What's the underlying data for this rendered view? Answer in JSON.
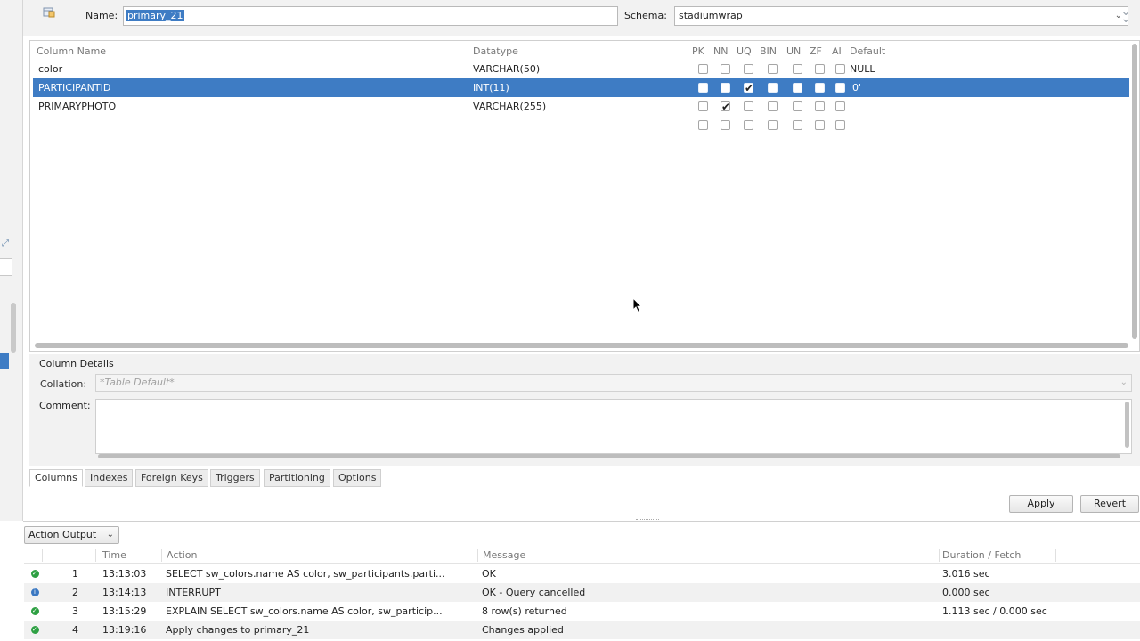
{
  "header": {
    "name_label": "Name:",
    "name_value": "primary_21",
    "schema_label": "Schema:",
    "schema_value": "stadiumwrap"
  },
  "grid": {
    "headers": {
      "column_name": "Column Name",
      "datatype": "Datatype",
      "pk": "PK",
      "nn": "NN",
      "uq": "UQ",
      "bin": "BIN",
      "un": "UN",
      "zf": "ZF",
      "ai": "AI",
      "default": "Default"
    },
    "rows": [
      {
        "name": "color",
        "datatype": "VARCHAR(50)",
        "pk": false,
        "nn": false,
        "uq": false,
        "bin": false,
        "un": false,
        "zf": false,
        "ai": false,
        "default": "NULL"
      },
      {
        "name": "PARTICIPANTID",
        "datatype": "INT(11)",
        "pk": false,
        "nn": false,
        "uq": true,
        "bin": false,
        "un": false,
        "zf": false,
        "ai": false,
        "default": "'0'",
        "selected": true
      },
      {
        "name": "PRIMARYPHOTO",
        "datatype": "VARCHAR(255)",
        "pk": false,
        "nn": true,
        "uq": false,
        "bin": false,
        "un": false,
        "zf": false,
        "ai": false,
        "default": ""
      },
      {
        "name": "",
        "datatype": "",
        "pk": false,
        "nn": false,
        "uq": false,
        "bin": false,
        "un": false,
        "zf": false,
        "ai": false,
        "default": ""
      }
    ]
  },
  "details": {
    "title": "Column Details",
    "collation_label": "Collation:",
    "collation_value": "*Table Default*",
    "comment_label": "Comment:"
  },
  "tabs": [
    "Columns",
    "Indexes",
    "Foreign Keys",
    "Triggers",
    "Partitioning",
    "Options"
  ],
  "active_tab": "Columns",
  "buttons": {
    "apply": "Apply",
    "revert": "Revert"
  },
  "output": {
    "selector": "Action Output",
    "headers": {
      "time": "Time",
      "action": "Action",
      "message": "Message",
      "duration": "Duration / Fetch"
    },
    "rows": [
      {
        "status": "ok",
        "num": "1",
        "time": "13:13:03",
        "action": "SELECT    sw_colors.name AS color,     sw_participants.parti...",
        "message": "OK",
        "duration": "3.016 sec"
      },
      {
        "status": "info",
        "num": "2",
        "time": "13:14:13",
        "action": "INTERRUPT",
        "message": "OK - Query cancelled",
        "duration": "0.000 sec"
      },
      {
        "status": "ok",
        "num": "3",
        "time": "13:15:29",
        "action": "EXPLAIN SELECT    sw_colors.name AS color,     sw_particip...",
        "message": "8 row(s) returned",
        "duration": "1.113 sec / 0.000 sec"
      },
      {
        "status": "ok",
        "num": "4",
        "time": "13:19:16",
        "action": "Apply changes to primary_21",
        "message": "Changes applied",
        "duration": ""
      }
    ]
  },
  "icons": {
    "table": "table-icon",
    "collapse": "double-chevron-down-icon",
    "status_ok": "check-circle-icon",
    "status_info": "info-circle-icon"
  },
  "colors": {
    "selection": "#3e7cc4",
    "ok": "#2ea043",
    "info": "#3a78c2"
  }
}
